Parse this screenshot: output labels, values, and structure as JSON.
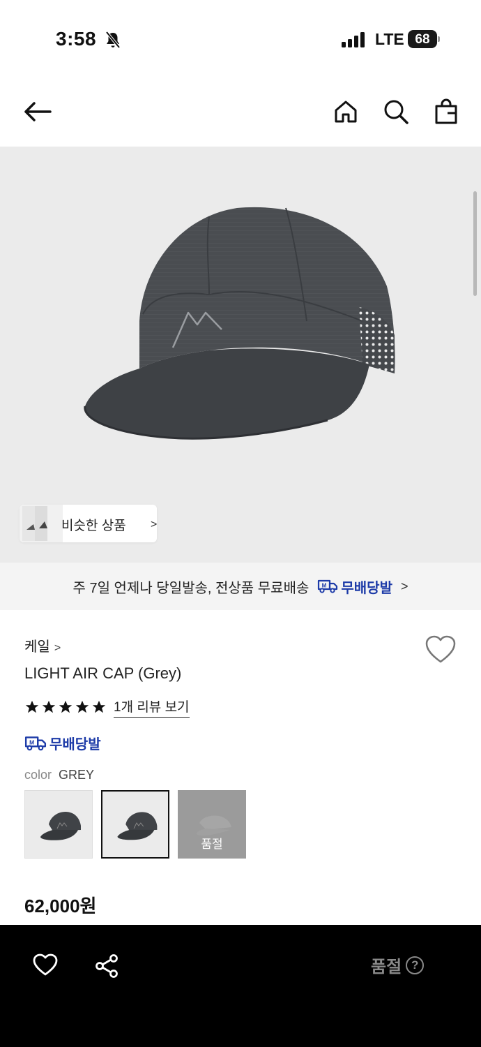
{
  "status_bar": {
    "time": "3:58",
    "network": "LTE",
    "battery": "68"
  },
  "similar": {
    "label": "비슷한 상품",
    "chevron": ">"
  },
  "shipping_banner": {
    "text": "주 7일 언제나 당일발송, 전상품 무료배송",
    "badge_label": "무배당발",
    "chevron": ">"
  },
  "product": {
    "brand": "케일",
    "brand_chevron": ">",
    "name": "LIGHT AIR CAP (Grey)",
    "rating_stars": 5,
    "review_link": "1개 리뷰 보기",
    "free_shipping_label": "무배당발",
    "color_key": "color",
    "color_value": "GREY",
    "options": [
      {
        "state": "available"
      },
      {
        "state": "selected"
      },
      {
        "state": "soldout",
        "label": "품절"
      }
    ],
    "price": "62,000원"
  },
  "bottom_bar": {
    "soldout_label": "품절",
    "help_glyph": "?"
  },
  "colors": {
    "accent_blue": "#1d3ba8",
    "hero_bg": "#ebebeb",
    "bottom_bar_bg": "#000000",
    "soldout_gray": "#8a8a8a"
  }
}
